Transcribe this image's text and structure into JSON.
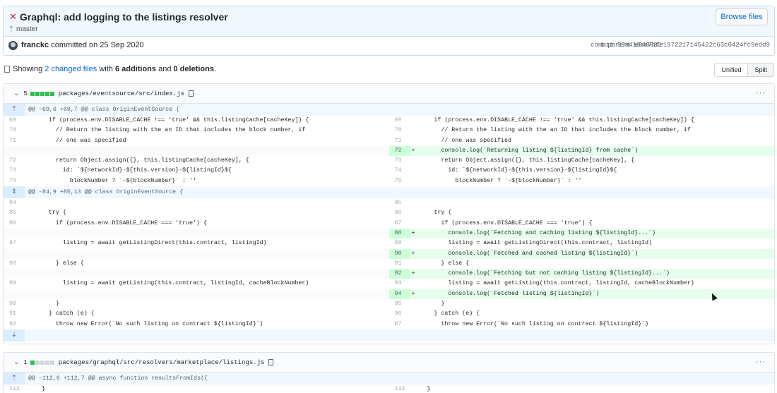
{
  "commit": {
    "title": "Graphql: add logging to the listings resolver",
    "branch": "master",
    "browse_label": "Browse files",
    "author": "franckc",
    "committed_text": "committed on 25 Sep 2020",
    "parent_label": "1 parent",
    "parent_sha": "e848682",
    "commit_label": "commit",
    "commit_sha": "55a418ea7bfe1972217145422c63c0424fc9edd9"
  },
  "summary": {
    "prefix": "Showing",
    "changed_files": "2 changed files",
    "mid1": "with",
    "additions": "6 additions",
    "mid2": "and",
    "deletions": "0 deletions",
    "suffix": "."
  },
  "view_toggle": {
    "unified": "Unified",
    "split": "Split",
    "selected": "Split"
  },
  "colors": {
    "addition_bg": "#e6ffed",
    "addition_num_bg": "#cdffd8",
    "hunk_bg": "#f1f8ff",
    "link": "#0366d6",
    "diffstat_add": "#2cbe4e"
  },
  "files": [
    {
      "changes": "5",
      "diffstat": [
        "add",
        "add",
        "add",
        "add",
        "add"
      ],
      "path": "packages/eventsource/src/index.js",
      "hunks": [
        {
          "header": "@@ -69,6 +69,7 @@ class OriginEventSource {"
        },
        {
          "header": "@@ -84,9 +85,13 @@ class OriginEventSource {"
        }
      ]
    },
    {
      "changes": "1",
      "diffstat": [
        "add",
        "neu",
        "neu",
        "neu",
        "neu"
      ],
      "path": "packages/graphql/src/resolvers/marketplace/listings.js",
      "hunks": [
        {
          "header": "@@ -112,6 +112,7 @@ async function resultsFromIds({"
        }
      ]
    }
  ],
  "diff1": {
    "rows": [
      {
        "l_num": "69",
        "l_code": "    if (process.env.DISABLE_CACHE !== 'true' && this.listingCache[cacheKey]) {",
        "r_num": "69",
        "r_code": "    if (process.env.DISABLE_CACHE !== 'true' && this.listingCache[cacheKey]) {",
        "add": false
      },
      {
        "l_num": "70",
        "l_code": "      // Return the listing with the an ID that includes the block number, if",
        "r_num": "70",
        "r_code": "      // Return the listing with the an ID that includes the block number, if",
        "add": false
      },
      {
        "l_num": "71",
        "l_code": "      // one was specified",
        "r_num": "71",
        "r_code": "      // one was specified",
        "add": false
      },
      {
        "l_num": "",
        "l_code": "",
        "r_num": "72",
        "r_code": "      console.log(`Returning listing ${listingId} from cache`)",
        "add": true
      },
      {
        "l_num": "72",
        "l_code": "      return Object.assign({}, this.listingCache[cacheKey], {",
        "r_num": "73",
        "r_code": "      return Object.assign({}, this.listingCache[cacheKey], {",
        "add": false
      },
      {
        "l_num": "73",
        "l_code": "        id: `${networkId}-${this.version}-${listingId}${",
        "r_num": "74",
        "r_code": "        id: `${networkId}-${this.version}-${listingId}${",
        "add": false
      },
      {
        "l_num": "74",
        "l_code": "          blockNumber ? `-${blockNumber}` : ''",
        "r_num": "75",
        "r_code": "          blockNumber ? `-${blockNumber}` : ''",
        "add": false
      }
    ],
    "rows2": [
      {
        "l_num": "84",
        "l_code": "",
        "r_num": "85",
        "r_code": "",
        "add": false
      },
      {
        "l_num": "85",
        "l_code": "    try {",
        "r_num": "86",
        "r_code": "    try {",
        "add": false
      },
      {
        "l_num": "86",
        "l_code": "      if (process.env.DISABLE_CACHE === 'true') {",
        "r_num": "87",
        "r_code": "      if (process.env.DISABLE_CACHE === 'true') {",
        "add": false
      },
      {
        "l_num": "",
        "l_code": "",
        "r_num": "88",
        "r_code": "        console.log(`Fetching and caching listing ${listingId}...`)",
        "add": true
      },
      {
        "l_num": "87",
        "l_code": "        listing = await getListingDirect(this.contract, listingId)",
        "r_num": "89",
        "r_code": "        listing = await getListingDirect(this.contract, listingId)",
        "add": false
      },
      {
        "l_num": "",
        "l_code": "",
        "r_num": "90",
        "r_code": "        console.log(`Fetched and cached listing ${listingId}`)",
        "add": true
      },
      {
        "l_num": "88",
        "l_code": "      } else {",
        "r_num": "91",
        "r_code": "      } else {",
        "add": false
      },
      {
        "l_num": "",
        "l_code": "",
        "r_num": "92",
        "r_code": "        console.log(`Fetching but not caching listing ${listingId}...`)",
        "add": true
      },
      {
        "l_num": "89",
        "l_code": "        listing = await getListing(this.contract, listingId, cacheBlockNumber)",
        "r_num": "93",
        "r_code": "        listing = await getListing(this.contract, listingId, cacheBlockNumber)",
        "add": false
      },
      {
        "l_num": "",
        "l_code": "",
        "r_num": "94",
        "r_code": "        console.log(`Fetched listing ${listingId}`)",
        "add": true
      },
      {
        "l_num": "90",
        "l_code": "      }",
        "r_num": "95",
        "r_code": "      }",
        "add": false
      },
      {
        "l_num": "91",
        "l_code": "    } catch (e) {",
        "r_num": "96",
        "r_code": "    } catch (e) {",
        "add": false
      },
      {
        "l_num": "92",
        "l_code": "      throw new Error(`No such listing on contract ${listingId}`)",
        "r_num": "97",
        "r_code": "      throw new Error(`No such listing on contract ${listingId}`)",
        "add": false
      }
    ]
  },
  "diff2": {
    "rows": [
      {
        "l_num": "112",
        "l_code": "  }",
        "r_num": "112",
        "r_code": "  }",
        "add": false
      }
    ]
  }
}
